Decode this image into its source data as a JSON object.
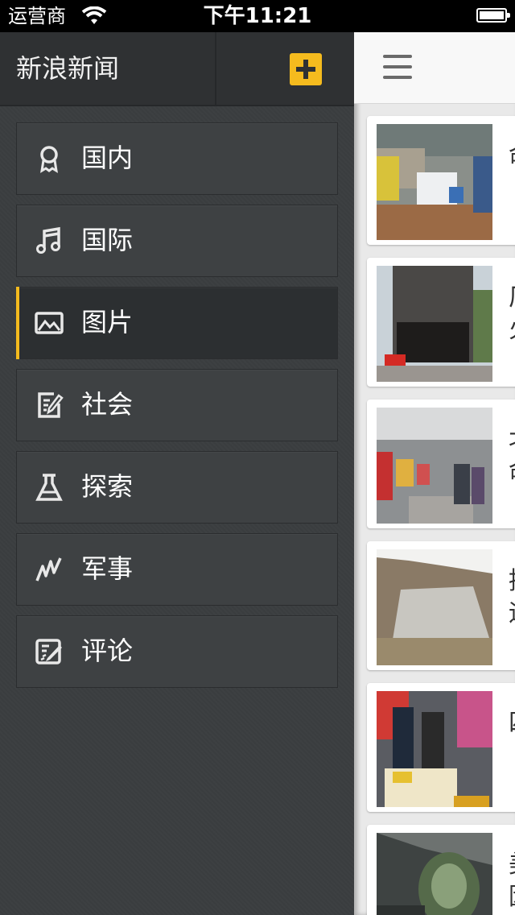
{
  "status_bar": {
    "carrier": "运营商",
    "time": "下午11:21"
  },
  "sidebar": {
    "title": "新浪新闻",
    "add_icon": "plus-icon",
    "accent_color": "#f5bb1e",
    "items": [
      {
        "label": "国内",
        "icon": "award-icon",
        "active": false
      },
      {
        "label": "国际",
        "icon": "music-note-icon",
        "active": false
      },
      {
        "label": "图片",
        "icon": "picture-icon",
        "active": true
      },
      {
        "label": "社会",
        "icon": "edit-icon",
        "active": false
      },
      {
        "label": "探索",
        "icon": "flask-icon",
        "active": false
      },
      {
        "label": "军事",
        "icon": "zigzag-icon",
        "active": false
      },
      {
        "label": "评论",
        "icon": "comment-edit-icon",
        "active": false
      }
    ]
  },
  "main": {
    "menu_icon": "hamburger-icon",
    "articles": [
      {
        "title_fragment": "命",
        "thumb": "flooded-street-photo"
      },
      {
        "title_fragment": "厂\n火",
        "thumb": "burned-building-photo"
      },
      {
        "title_fragment": "北\n命",
        "thumb": "subway-platform-photo"
      },
      {
        "title_fragment": "捂\n运",
        "thumb": "quarry-slab-photo"
      },
      {
        "title_fragment": "四",
        "thumb": "street-market-photo"
      },
      {
        "title_fragment": "美\n因",
        "thumb": "helmet-closeup-photo"
      }
    ]
  }
}
